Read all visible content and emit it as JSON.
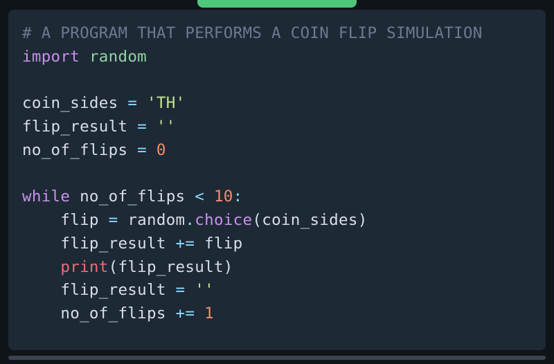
{
  "tab": {
    "visible": true
  },
  "code": {
    "lines": [
      [
        {
          "cls": "tok-comment",
          "text": "# A PROGRAM THAT PERFORMS A COIN FLIP SIMULATION"
        }
      ],
      [
        {
          "cls": "tok-keyword",
          "text": "import"
        },
        {
          "cls": "tok-ident",
          "text": " "
        },
        {
          "cls": "tok-module",
          "text": "random"
        }
      ],
      [
        {
          "cls": "tok-ident",
          "text": ""
        }
      ],
      [
        {
          "cls": "tok-ident",
          "text": "coin_sides "
        },
        {
          "cls": "tok-op",
          "text": "="
        },
        {
          "cls": "tok-ident",
          "text": " "
        },
        {
          "cls": "tok-string",
          "text": "'TH'"
        }
      ],
      [
        {
          "cls": "tok-ident",
          "text": "flip_result "
        },
        {
          "cls": "tok-op",
          "text": "="
        },
        {
          "cls": "tok-ident",
          "text": " "
        },
        {
          "cls": "tok-string",
          "text": "''"
        }
      ],
      [
        {
          "cls": "tok-ident",
          "text": "no_of_flips "
        },
        {
          "cls": "tok-op",
          "text": "="
        },
        {
          "cls": "tok-ident",
          "text": " "
        },
        {
          "cls": "tok-number",
          "text": "0"
        }
      ],
      [
        {
          "cls": "tok-ident",
          "text": ""
        }
      ],
      [
        {
          "cls": "tok-keyword",
          "text": "while"
        },
        {
          "cls": "tok-ident",
          "text": " no_of_flips "
        },
        {
          "cls": "tok-op",
          "text": "<"
        },
        {
          "cls": "tok-ident",
          "text": " "
        },
        {
          "cls": "tok-number",
          "text": "10"
        },
        {
          "cls": "tok-punct",
          "text": ":"
        }
      ],
      [
        {
          "cls": "tok-ident",
          "text": "    flip "
        },
        {
          "cls": "tok-op",
          "text": "="
        },
        {
          "cls": "tok-ident",
          "text": " random"
        },
        {
          "cls": "tok-punct",
          "text": "."
        },
        {
          "cls": "tok-method",
          "text": "choice"
        },
        {
          "cls": "tok-paren",
          "text": "("
        },
        {
          "cls": "tok-ident",
          "text": "coin_sides"
        },
        {
          "cls": "tok-paren",
          "text": ")"
        }
      ],
      [
        {
          "cls": "tok-ident",
          "text": "    flip_result "
        },
        {
          "cls": "tok-op",
          "text": "+="
        },
        {
          "cls": "tok-ident",
          "text": " flip"
        }
      ],
      [
        {
          "cls": "tok-ident",
          "text": "    "
        },
        {
          "cls": "tok-func",
          "text": "print"
        },
        {
          "cls": "tok-paren",
          "text": "("
        },
        {
          "cls": "tok-ident",
          "text": "flip_result"
        },
        {
          "cls": "tok-paren",
          "text": ")"
        }
      ],
      [
        {
          "cls": "tok-ident",
          "text": "    flip_result "
        },
        {
          "cls": "tok-op",
          "text": "="
        },
        {
          "cls": "tok-ident",
          "text": " "
        },
        {
          "cls": "tok-string",
          "text": "''"
        }
      ],
      [
        {
          "cls": "tok-ident",
          "text": "    no_of_flips "
        },
        {
          "cls": "tok-op",
          "text": "+="
        },
        {
          "cls": "tok-ident",
          "text": " "
        },
        {
          "cls": "tok-number",
          "text": "1"
        }
      ]
    ]
  }
}
